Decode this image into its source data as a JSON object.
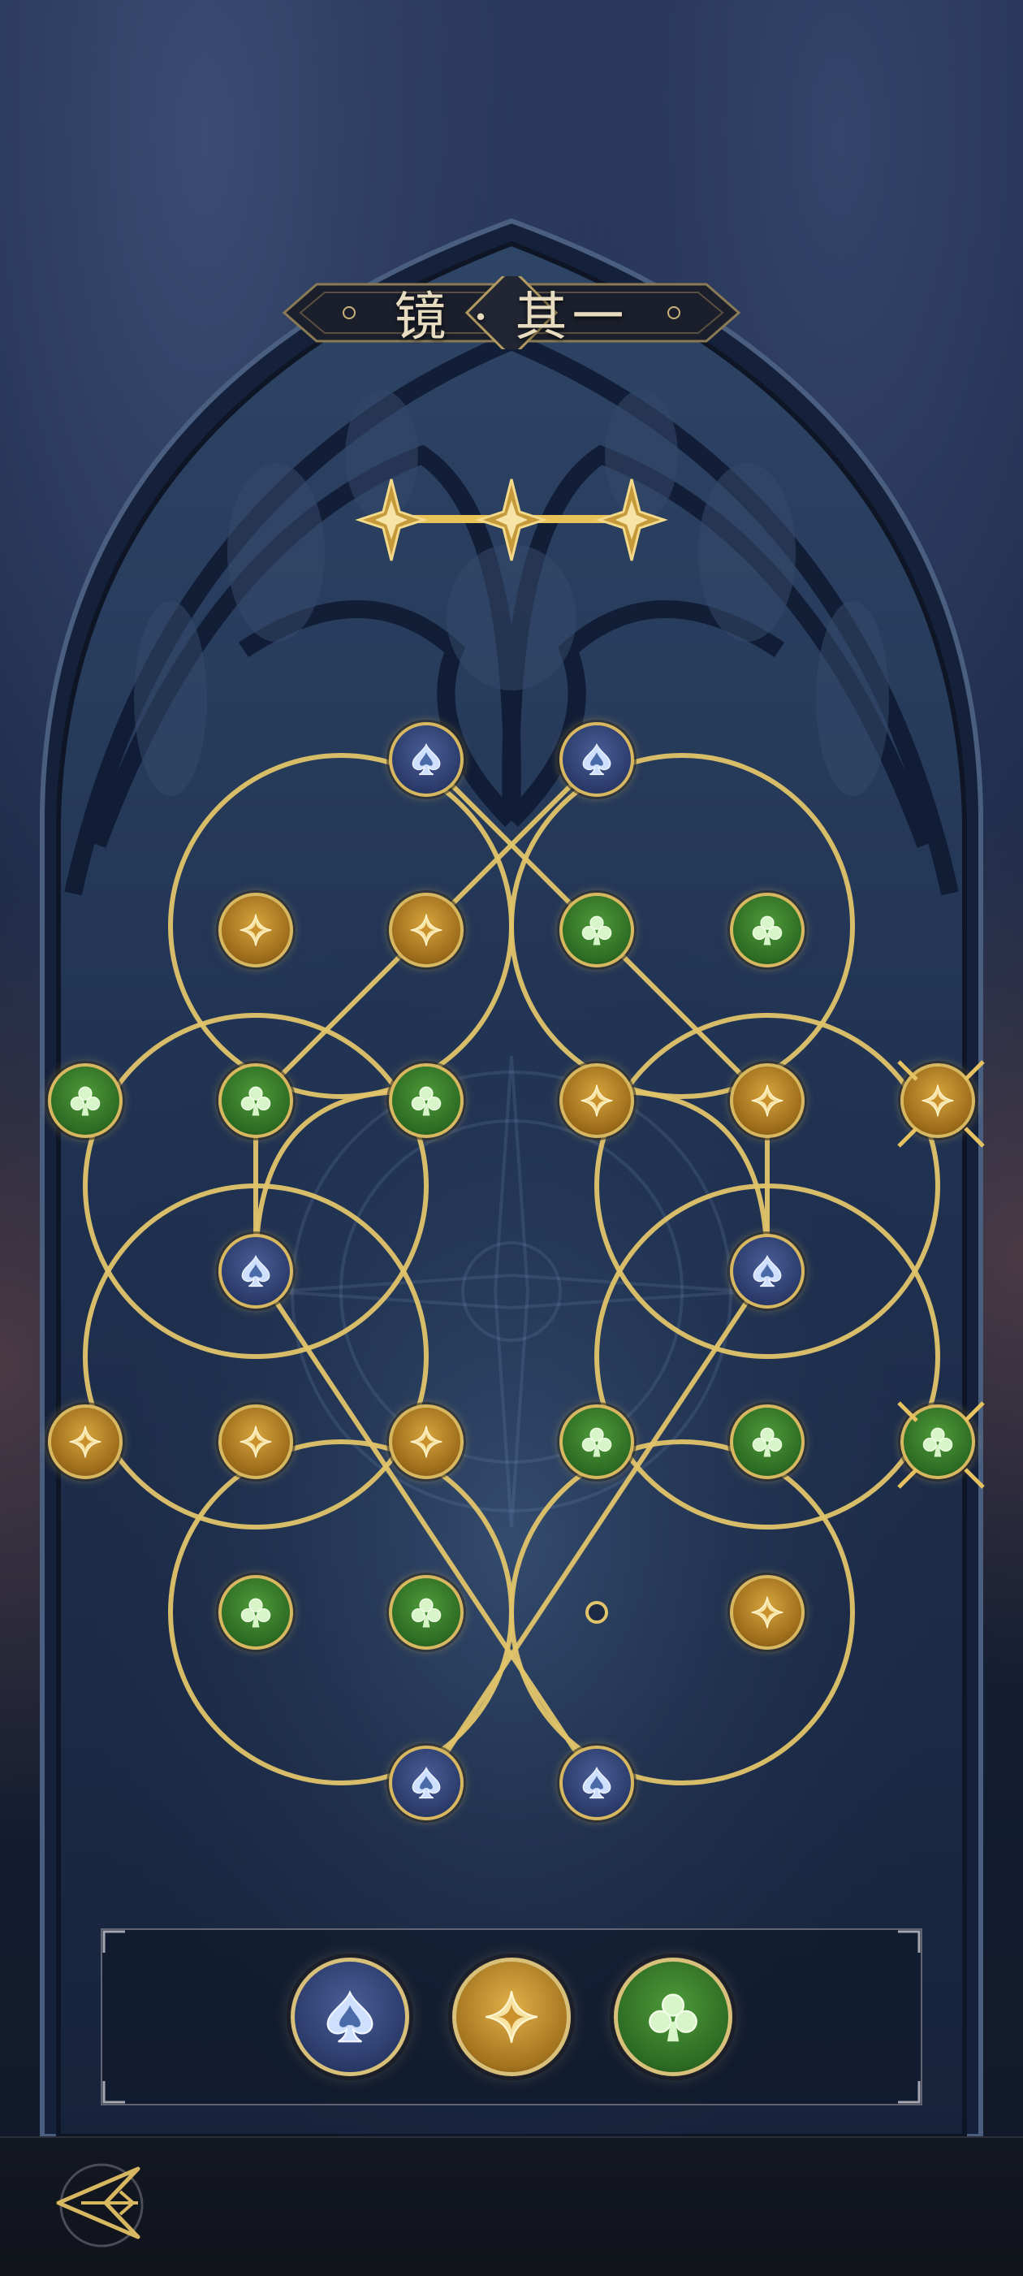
{
  "header": {
    "title": "镜 · 其一",
    "progress_stars_total": 3,
    "progress_stars_lit": 3
  },
  "colors": {
    "gold": "#d8b761",
    "spade_blue": "#2a3a6a",
    "star_gold": "#b07d22",
    "club_green": "#2c6b23",
    "stone": "#2a3e5e"
  },
  "board": {
    "nodes": [
      {
        "id": "n1",
        "type": "spade"
      },
      {
        "id": "n2",
        "type": "spade"
      },
      {
        "id": "n3",
        "type": "star"
      },
      {
        "id": "n4",
        "type": "star"
      },
      {
        "id": "n5",
        "type": "club"
      },
      {
        "id": "n6",
        "type": "club"
      },
      {
        "id": "n7",
        "type": "club"
      },
      {
        "id": "n8",
        "type": "club"
      },
      {
        "id": "n9",
        "type": "club"
      },
      {
        "id": "n10",
        "type": "star"
      },
      {
        "id": "n11",
        "type": "star"
      },
      {
        "id": "n12",
        "type": "star",
        "marked": true
      },
      {
        "id": "n13",
        "type": "spade"
      },
      {
        "id": "n14",
        "type": "spade"
      },
      {
        "id": "n15",
        "type": "star"
      },
      {
        "id": "n16",
        "type": "star"
      },
      {
        "id": "n17",
        "type": "star"
      },
      {
        "id": "n18",
        "type": "club"
      },
      {
        "id": "n19",
        "type": "club"
      },
      {
        "id": "n20",
        "type": "club",
        "marked": true
      },
      {
        "id": "n21",
        "type": "club"
      },
      {
        "id": "n22",
        "type": "club"
      },
      {
        "id": "n23",
        "type": "star"
      },
      {
        "id": "n24",
        "type": "spade"
      },
      {
        "id": "n25",
        "type": "spade"
      }
    ]
  },
  "legend": {
    "items": [
      {
        "type": "spade",
        "icon": "spade-icon"
      },
      {
        "type": "star",
        "icon": "four-point-star-icon"
      },
      {
        "type": "club",
        "icon": "club-icon"
      }
    ]
  },
  "footer": {
    "back_icon": "back-arrow-icon"
  }
}
